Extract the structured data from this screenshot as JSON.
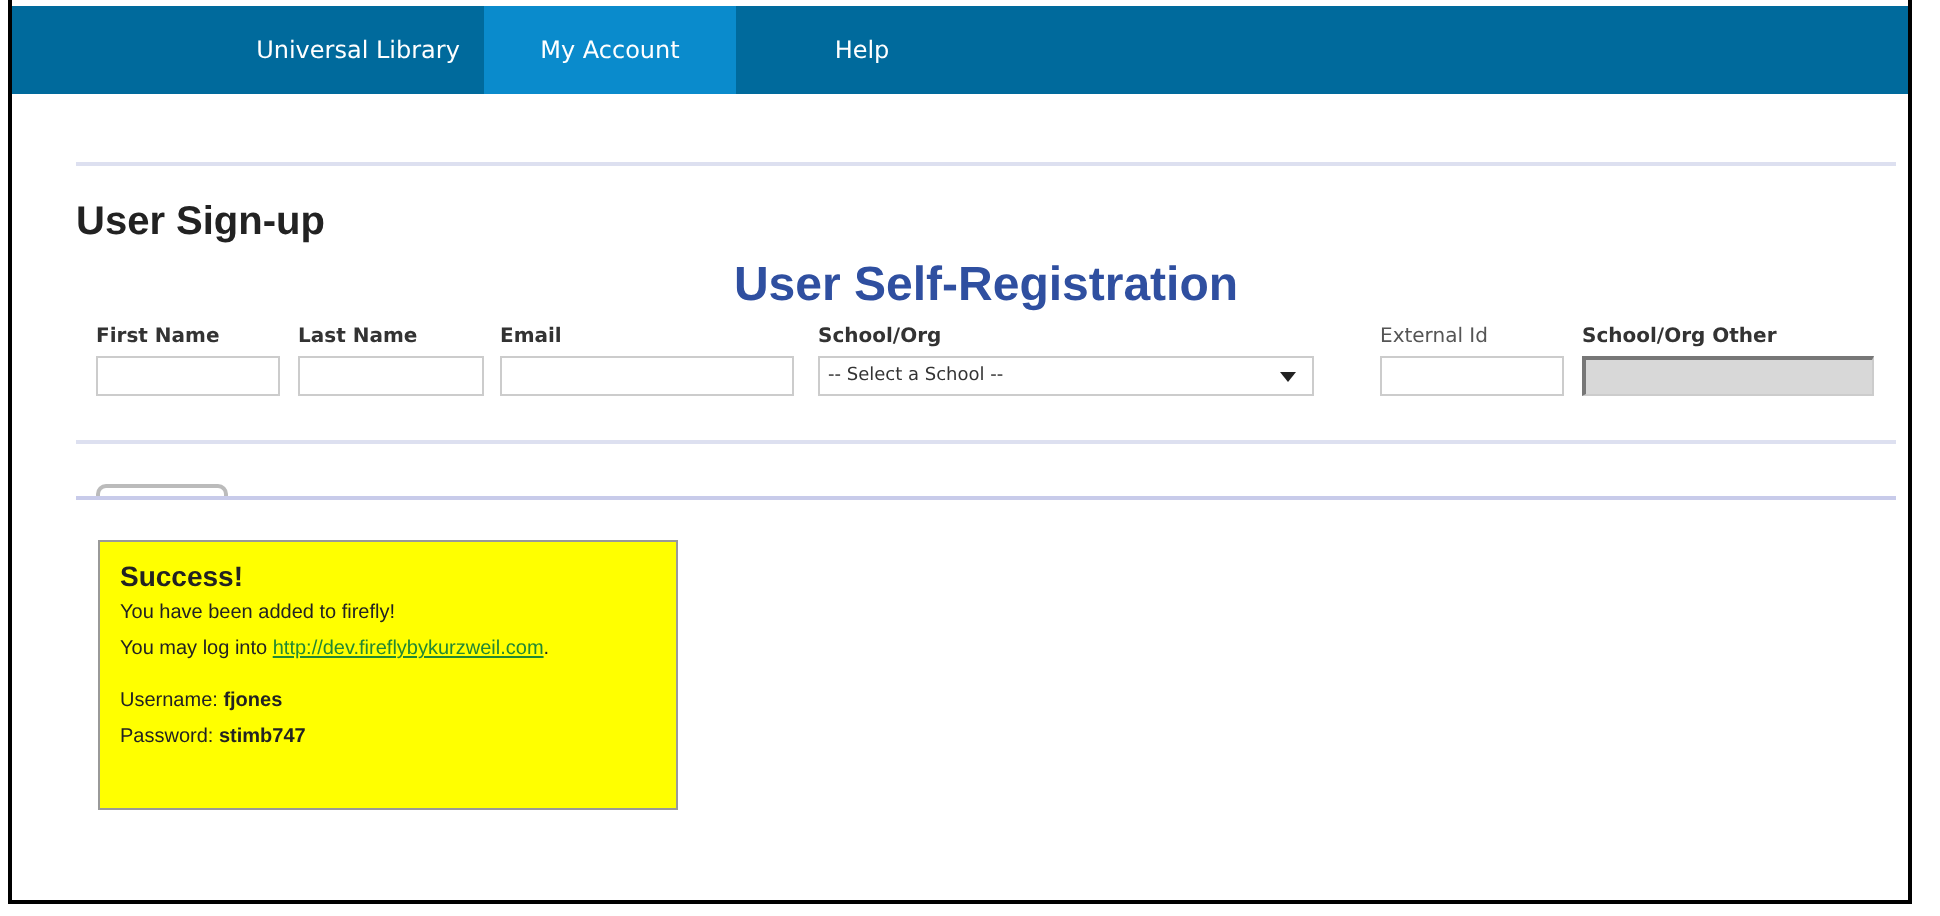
{
  "nav": {
    "items": [
      {
        "label": "Universal Library",
        "selected": false
      },
      {
        "label": "My Account",
        "selected": true
      },
      {
        "label": "Help",
        "selected": false
      }
    ]
  },
  "page_title": "User Sign-up",
  "form": {
    "heading": "User Self-Registration",
    "fields": [
      {
        "label": "First Name",
        "kind": "text"
      },
      {
        "label": "Last Name",
        "kind": "text"
      },
      {
        "label": "Email",
        "kind": "text"
      },
      {
        "label": "School/Org",
        "kind": "select",
        "value": "-- Select a School --"
      },
      {
        "label": "External Id",
        "kind": "optional"
      },
      {
        "label": "School/Org Other",
        "kind": "locked"
      }
    ]
  },
  "message": {
    "title": "Success!",
    "line_1": "You have been added to firefly!",
    "line_2_before": "You may log into ",
    "link": "http://dev.fireflybykurzweil.com",
    "line_2_after": ".",
    "username": "Username: **fjones**",
    "password": "Password: **stimb747**"
  }
}
